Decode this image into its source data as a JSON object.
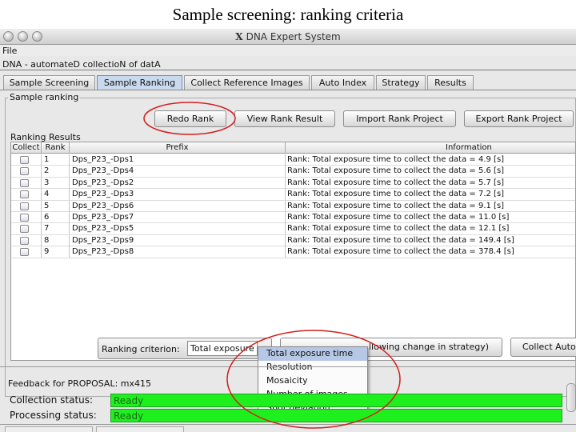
{
  "slide_title": "Sample screening:  ranking criteria",
  "window": {
    "title": "DNA Expert System",
    "title_icon": "X",
    "menu": [
      "File"
    ],
    "project_label": "DNA - automateD collectioN of datA"
  },
  "tabs": [
    "Sample Screening",
    "Sample Ranking",
    "Collect Reference Images",
    "Auto Index",
    "Strategy",
    "Results"
  ],
  "active_tab": "Sample Ranking",
  "sample_ranking": {
    "group_label": "Sample ranking",
    "buttons": {
      "redo": "Redo Rank",
      "view": "View Rank Result",
      "import": "Import Rank Project",
      "export": "Export Rank Project"
    },
    "results_label": "Ranking Results",
    "columns": [
      "Collect",
      "Rank",
      "Prefix",
      "Information"
    ],
    "rows": [
      {
        "rank": "1",
        "prefix": "Dps_P23_-Dps1",
        "info": "Rank: Total exposure time to collect the data = 4.9 [s]"
      },
      {
        "rank": "2",
        "prefix": "Dps_P23_-Dps4",
        "info": "Rank: Total exposure time to collect the data = 5.6 [s]"
      },
      {
        "rank": "3",
        "prefix": "Dps_P23_-Dps2",
        "info": "Rank: Total exposure time to collect the data = 5.7 [s]"
      },
      {
        "rank": "4",
        "prefix": "Dps_P23_-Dps3",
        "info": "Rank: Total exposure time to collect the data = 7.2 [s]"
      },
      {
        "rank": "5",
        "prefix": "Dps_P23_-Dps6",
        "info": "Rank: Total exposure time to collect the data = 9.1 [s]"
      },
      {
        "rank": "6",
        "prefix": "Dps_P23_-Dps7",
        "info": "Rank: Total exposure time to collect the data = 11.0 [s]"
      },
      {
        "rank": "7",
        "prefix": "Dps_P23_-Dps5",
        "info": "Rank: Total exposure time to collect the data = 12.1 [s]"
      },
      {
        "rank": "8",
        "prefix": "Dps_P23_-Dps9",
        "info": "Rank: Total exposure time to collect the data = 149.4 [s]"
      },
      {
        "rank": "9",
        "prefix": "Dps_P23_-Dps8",
        "info": "Rank: Total exposure time to collect the data = 378.4 [s]"
      }
    ],
    "criterion_label": "Ranking criterion:",
    "criterion_value": "Total exposure time",
    "criterion_options": [
      "Total exposure time",
      "Resolution",
      "Mosaicity",
      "Number of images",
      "Spot deviation"
    ],
    "middle_button_fragment": "llowing change in strategy)",
    "collect_button": "Collect Auto"
  },
  "feedback": {
    "label": "Feedback for PROPOSAL: mx415",
    "collection_label": "Collection status:",
    "collection_value": "Ready",
    "processing_label": "Processing status:",
    "processing_value": "Ready"
  },
  "colors": {
    "annotation_circle": "#d42020",
    "status_green": "#1ef01e",
    "active_tab": "#c9d9ee",
    "selected_option": "#b7c8e6"
  }
}
